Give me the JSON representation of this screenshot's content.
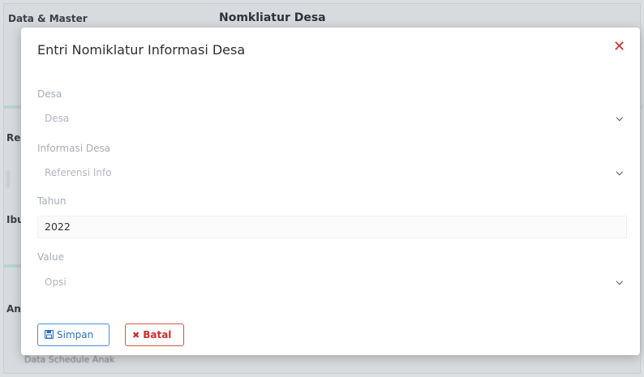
{
  "background": {
    "breadcrumb": "Data & Master",
    "page_title": "Nomkliatur Desa",
    "side_labels": [
      "Re",
      "Ibu",
      "An"
    ],
    "bottom_text": "Data Schedule Anak"
  },
  "modal": {
    "title": "Entri Nomiklatur Informasi Desa",
    "close_glyph": "✕",
    "fields": [
      {
        "label": "Desa",
        "value": "Desa",
        "is_placeholder": true,
        "type": "select"
      },
      {
        "label": "Informasi Desa",
        "value": "Referensi Info",
        "is_placeholder": true,
        "type": "select"
      },
      {
        "label": "Tahun",
        "value": "2022",
        "is_placeholder": false,
        "type": "input"
      },
      {
        "label": "Value",
        "value": "Opsi",
        "is_placeholder": true,
        "type": "select"
      }
    ],
    "buttons": {
      "save_label": "Simpan",
      "save_icon": "floppy-disk-icon",
      "cancel_label": "Batal",
      "cancel_icon": "x-icon"
    }
  },
  "colors": {
    "save": "#2f6fbf",
    "cancel": "#c9302c",
    "close": "#c9302c"
  }
}
